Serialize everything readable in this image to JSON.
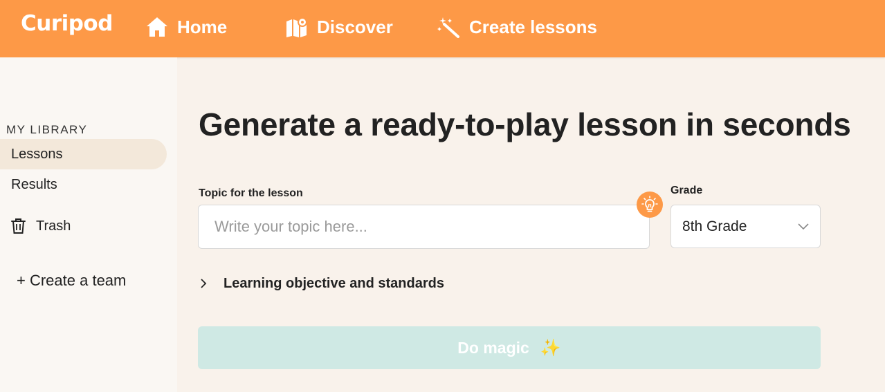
{
  "brand": {
    "logo_text": "Curipod"
  },
  "nav": {
    "home": "Home",
    "discover": "Discover",
    "create_lessons": "Create lessons"
  },
  "sidebar": {
    "heading": "MY LIBRARY",
    "items": [
      {
        "label": "Lessons",
        "active": true
      },
      {
        "label": "Results"
      },
      {
        "label": "Trash"
      }
    ],
    "create_team": "+ Create a team"
  },
  "main": {
    "title": "Generate a ready-to-play lesson in seconds",
    "topic": {
      "label": "Topic for the lesson",
      "placeholder": "Write your topic here...",
      "value": ""
    },
    "grade": {
      "label": "Grade",
      "selected": "8th Grade"
    },
    "objective_toggle": "Learning objective and standards",
    "magic_button": "Do magic",
    "magic_sparkle": "✨"
  },
  "colors": {
    "header": "#fd9947",
    "background": "#f9f2eb",
    "sidebar": "#faf7f3",
    "active_item": "#f3e8da",
    "magic_button_disabled": "#cfe9e4"
  }
}
